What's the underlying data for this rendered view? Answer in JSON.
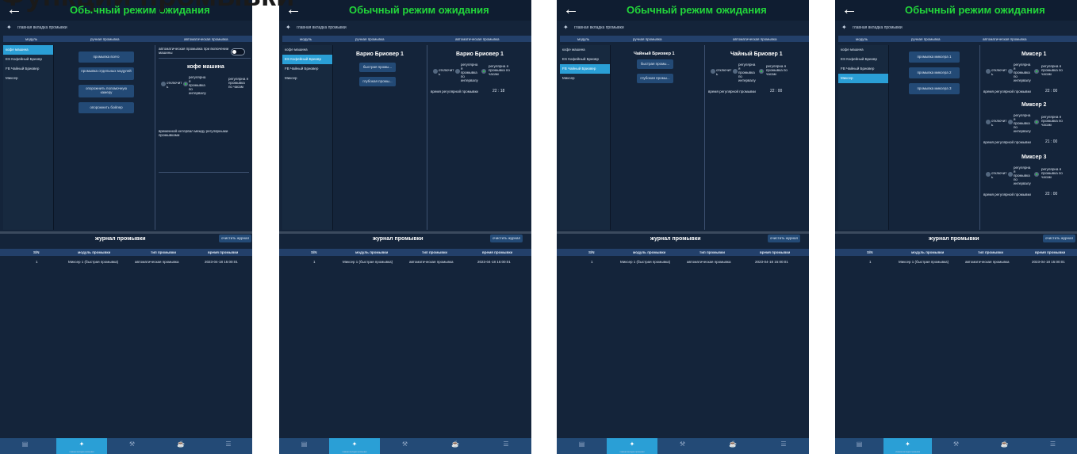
{
  "heading_partial": "Функции промывки",
  "common": {
    "back_icon": "arrow-left-icon",
    "title": "Обычный режим ожидания",
    "subtitle": "главная вкладка промывки",
    "col_module": "модуль",
    "col_manual": "ручная промывка",
    "col_auto": "автоматическая промывка",
    "log_title": "журнал промывки",
    "clear_btn": "очистить журнал",
    "log_headers": [
      "S/N",
      "модуль промывки",
      "тип промывки",
      "время промывки"
    ],
    "log_row": [
      "1",
      "Миксер 1 (быстрая промывка)",
      "автоматическая промывка",
      "2023-04-18 15:00:01"
    ],
    "tab_icons": [
      "book-icon",
      "broom-icon",
      "tools-icon",
      "cup-icon",
      "list-icon"
    ],
    "tab_labels": [
      "",
      "главная вкладка промывки",
      "",
      "",
      ""
    ],
    "active_color": "#2a9fd6",
    "title_color": "#22d63a"
  },
  "modules": [
    "кофе машина",
    "ES Кофейный Бриовр",
    "FB Чайный Бриовер",
    "Миксер"
  ],
  "screen1": {
    "manual_buttons": [
      "промывка всего",
      "промывка отдельных модулей",
      "опорожнить пол­омочную камеру",
      "опорожнить бойлер"
    ],
    "auto_on_power": "автоматическая промывка при включении машины",
    "device": "кофе машина",
    "opt_off": "отключит ь",
    "opt_interval": "регулярна я промывка по интервалу",
    "opt_hours": "регулярна я промывка по часам",
    "interval_label": "временной интервал между регулярными промывками"
  },
  "screen2": {
    "manual_title": "Варио Бриовер 1",
    "manual_buttons": [
      "быстрая промы...",
      "глубокая промы..."
    ],
    "device": "Варио Бриовер 1",
    "opt_off": "отключит ь",
    "opt_interval": "регулярна я промывка по интервалу",
    "opt_hours": "регулярна я промывка по часам",
    "time_label": "время регулярной промывки",
    "time_value": "22 : 18"
  },
  "screen3": {
    "manual_title": "Чайный Бриовер 1",
    "manual_buttons": [
      "быстрая промы...",
      "глубокая промы..."
    ],
    "device": "Чайный Бриовер 1",
    "opt_off": "отключит ь",
    "opt_interval": "регулярна я промывка по интервалу",
    "opt_hours": "регулярна я промывка по часам",
    "time_label": "время регулярной промывки",
    "time_value": "22 : 00"
  },
  "screen4": {
    "manual_buttons": [
      "промывка миксера 1",
      "промывка миксера 2",
      "промывка миксера 3"
    ],
    "mixers": [
      {
        "name": "Миксер 1",
        "time": "22 : 00"
      },
      {
        "name": "Миксер 2",
        "time": "21 : 00"
      },
      {
        "name": "Миксер 3",
        "time": "22 : 00"
      }
    ],
    "opt_off": "отключит ь",
    "opt_interval": "регулярна я промывка по интервалу",
    "opt_hours": "регулярна я промывка по часам",
    "time_label": "время регулярной промывки"
  }
}
